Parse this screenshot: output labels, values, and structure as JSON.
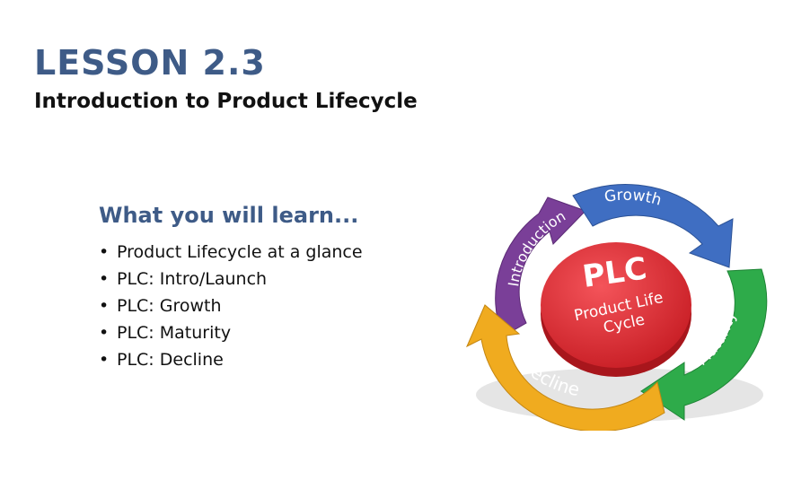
{
  "slide": {
    "title": "LESSON 2.3",
    "subtitle": "Introduction to Product Lifecycle"
  },
  "learn": {
    "heading": "What you will learn...",
    "bullet": "•",
    "items": [
      "Product Lifecycle at a glance",
      "PLC: Intro/Launch",
      "PLC: Growth",
      "PLC: Maturity",
      "PLC: Decline"
    ]
  },
  "diagram": {
    "center_title": "PLC",
    "center_line1": "Product Life",
    "center_line2": "Cycle",
    "stages": [
      {
        "label": "Introduction",
        "color": "#7a3f98"
      },
      {
        "label": "Growth",
        "color": "#3f6ec2"
      },
      {
        "label": "Maturity",
        "color": "#2eab4a"
      },
      {
        "label": "Decline",
        "color": "#f0ab1f"
      }
    ],
    "center_color": "#e53238"
  }
}
